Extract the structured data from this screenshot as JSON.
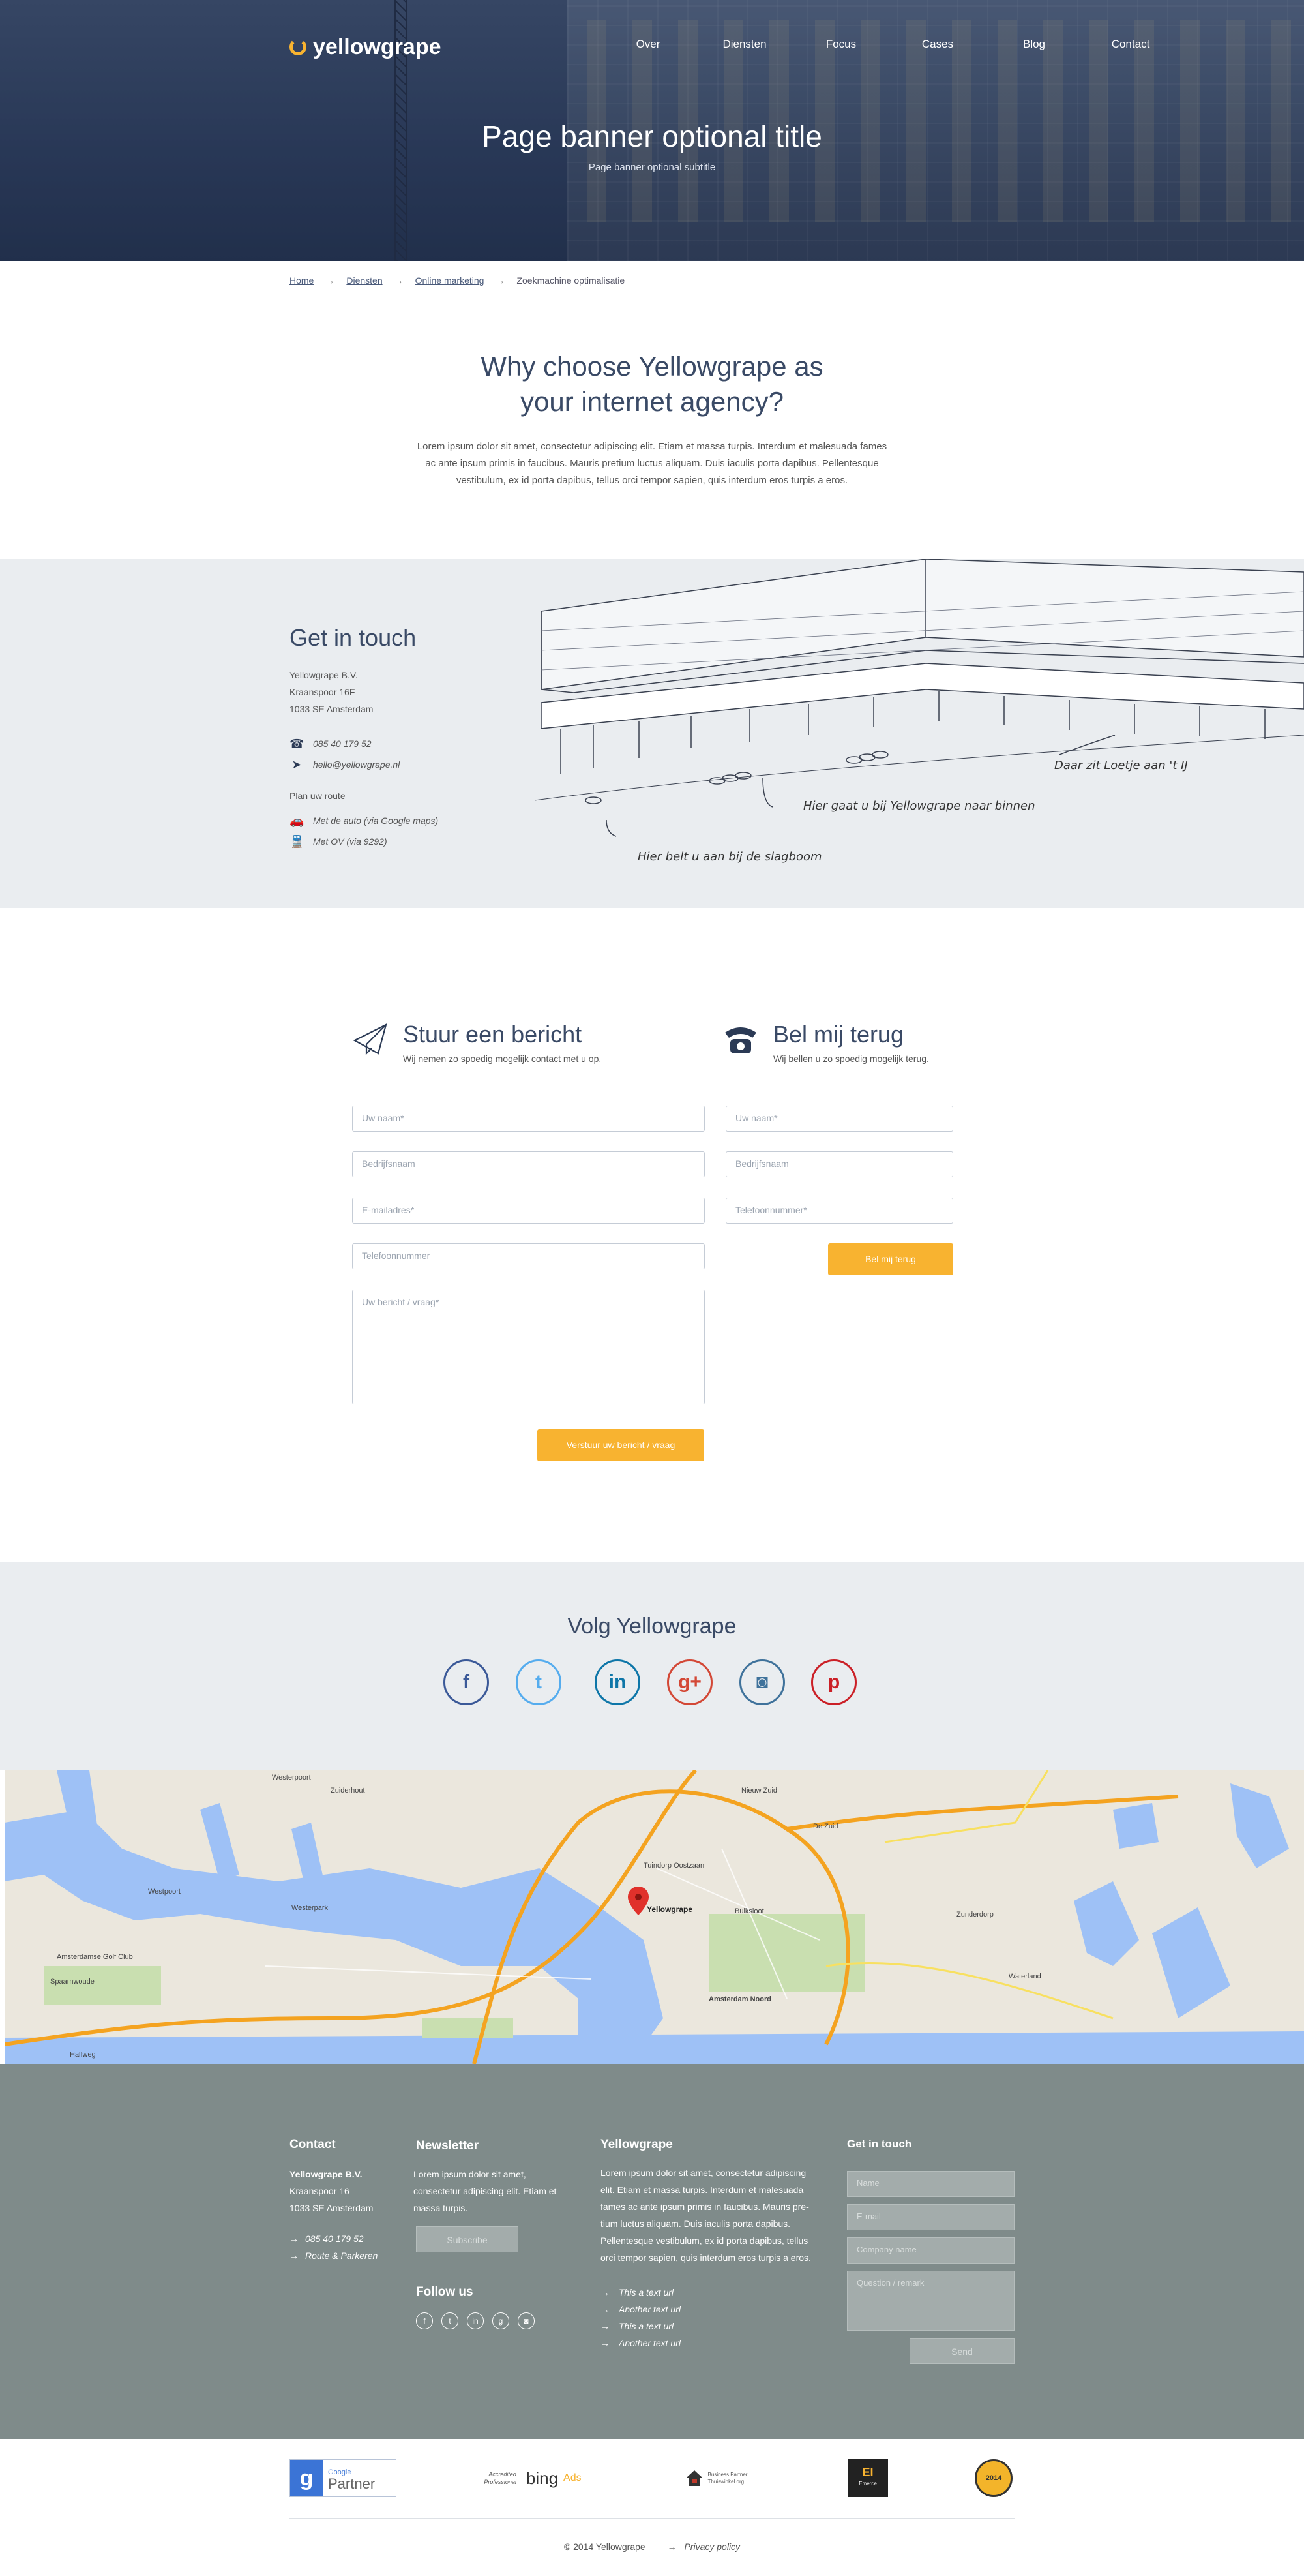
{
  "brand": {
    "name": "yellowgrape",
    "accent": "#f8b330",
    "navy": "#3a4a66"
  },
  "nav": [
    "Over",
    "Diensten",
    "Focus",
    "Cases",
    "Blog",
    "Contact"
  ],
  "hero": {
    "title": "Page banner optional title",
    "subtitle": "Page banner optional subtitle"
  },
  "breadcrumb": [
    "Home",
    "Diensten",
    "Online marketing",
    "Zoekmachine optimalisatie"
  ],
  "why": {
    "title_line1": "Why choose Yellowgrape as",
    "title_line2": "your internet agency?",
    "text_line1": "Lorem ipsum dolor sit amet, consectetur adipiscing elit. Etiam et massa turpis. Interdum et malesuada fames",
    "text_line2": "ac ante ipsum primis in faucibus. Mauris pretium luctus aliquam. Duis iaculis porta dapibus. Pellentesque",
    "text_line3": "vestibulum, ex id porta dapibus, tellus orci tempor sapien, quis interdum eros turpis a eros."
  },
  "contact": {
    "title": "Get in touch",
    "company": "Yellowgrape B.V.",
    "street": "Kraanspoor 16F",
    "city": "1033 SE Amsterdam",
    "phone": "085 40 179 52",
    "email": "hello@yellowgrape.nl",
    "route_title": "Plan uw route",
    "route_car": "Met de auto (via Google maps)",
    "route_ov": "Met OV (via 9292)",
    "note1": "Daar zit Loetje aan 't IJ",
    "note2": "Hier gaat u bij Yellowgrape naar binnen",
    "note3": "Hier belt u aan bij de slagboom"
  },
  "message_form": {
    "title": "Stuur een bericht",
    "subtitle": "Wij nemen zo spoedig mogelijk contact met u op.",
    "name": "Uw naam*",
    "company": "Bedrijfsnaam",
    "email": "E-mailadres*",
    "phone": "Telefoonnummer",
    "message": "Uw bericht / vraag*",
    "submit": "Verstuur uw bericht / vraag"
  },
  "callback_form": {
    "title": "Bel mij terug",
    "subtitle": "Wij bellen u zo spoedig mogelijk terug.",
    "name": "Uw naam*",
    "company": "Bedrijfsnaam",
    "phone": "Telefoonnummer*",
    "submit": "Bel mij terug"
  },
  "follow": {
    "title": "Volg Yellowgrape",
    "networks": [
      {
        "icon": "facebook-icon",
        "glyph": "f",
        "color": "#3b5998"
      },
      {
        "icon": "twitter-icon",
        "glyph": "t",
        "color": "#55acee"
      },
      {
        "icon": "linkedin-icon",
        "glyph": "in",
        "color": "#0e76a8"
      },
      {
        "icon": "googleplus-icon",
        "glyph": "g+",
        "color": "#d34836"
      },
      {
        "icon": "instagram-icon",
        "glyph": "◙",
        "color": "#3f729b"
      },
      {
        "icon": "pinterest-icon",
        "glyph": "p",
        "color": "#cb2027"
      }
    ]
  },
  "map": {
    "marker_label": "Yellowgrape",
    "labels": [
      "Westerpoort",
      "Zuiderhout",
      "Nieuw Zuid",
      "De Zuid",
      "Westerpark",
      "Zunderdorp",
      "Amsterdamse Golf Club",
      "Spaarnwoude",
      "Amsterdam Noord",
      "Waterland",
      "Westpoort",
      "Buiksloot",
      "Tuindorp Oostzaan",
      "Halfweg"
    ]
  },
  "footer": {
    "contact_title": "Contact",
    "company": "Yellowgrape B.V.",
    "street": "Kraanspoor 16",
    "city": "1033 SE Amsterdam",
    "phone": "085 40 179 52",
    "route": "Route & Parkeren",
    "newsletter_title": "Newsletter",
    "newsletter_line1": "Lorem ipsum dolor sit amet,",
    "newsletter_line2": "consectetur adipiscing elit. Etiam et",
    "newsletter_line3": "massa turpis.",
    "subscribe": "Subscribe",
    "follow_title": "Follow us",
    "about_title": "Yellowgrape",
    "about_lines": [
      "Lorem ipsum dolor sit amet, consectetur adipiscing",
      "elit. Etiam et massa turpis. Interdum et malesuada",
      "fames ac ante ipsum primis in faucibus. Mauris pre-",
      "tium luctus aliquam. Duis iaculis porta dapibus.",
      "Pellentesque vestibulum, ex id porta dapibus, tellus",
      "orci tempor sapien, quis interdum eros turpis a eros."
    ],
    "links": [
      "This a text url",
      "Another text url",
      "This a text url",
      "Another text url"
    ],
    "touch_title": "Get in touch",
    "touch_name": "Name",
    "touch_email": "E-mail",
    "touch_company": "Company name",
    "touch_question": "Question / remark",
    "touch_send": "Send"
  },
  "partners": {
    "google_small": "Google",
    "google_big": "Partner",
    "bing_l1": "Accredited",
    "bing_l2": "Professional",
    "bing_big": "bing",
    "bing_ads": "Ads",
    "bp_l1": "Business Partner",
    "bp_l2": "Thuiswinkel.org",
    "ei": "EI",
    "ei_sub": "Emerce",
    "badge": "2014"
  },
  "copyright": "© 2014 Yellowgrape",
  "privacy": "Privacy policy"
}
